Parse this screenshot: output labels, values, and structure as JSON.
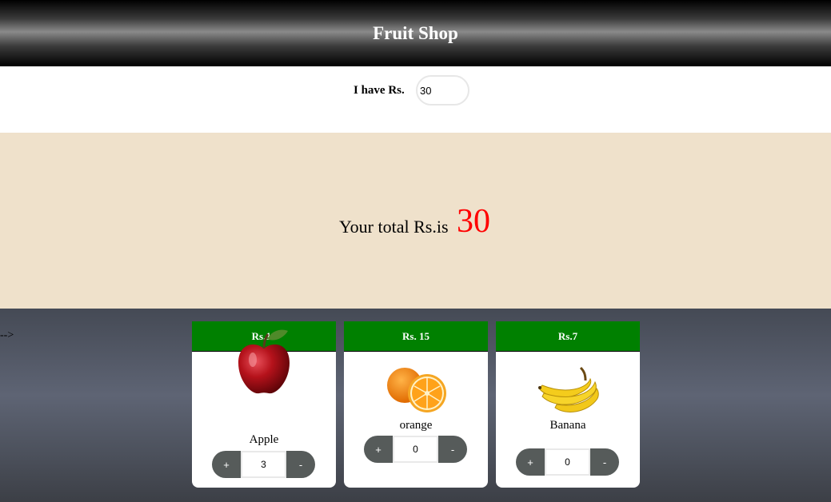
{
  "header": {
    "title": "Fruit Shop"
  },
  "budget": {
    "label": "I have Rs.",
    "value": "30"
  },
  "total": {
    "label": "Your total Rs.is",
    "value": "30",
    "value_color": "#ff0000"
  },
  "comment_arrow": "-->",
  "colors": {
    "card_header": "#008000",
    "total_band": "#efe1cb",
    "button": "#565b5a"
  },
  "products": [
    {
      "price": "Rs.10",
      "name": "Apple",
      "icon": "apple-icon",
      "plus": "+",
      "qty": "3",
      "minus": "-"
    },
    {
      "price": "Rs. 15",
      "name": "orange",
      "icon": "orange-icon",
      "plus": "+",
      "qty": "0",
      "minus": "-"
    },
    {
      "price": "Rs.7",
      "name": "Banana",
      "icon": "banana-icon",
      "plus": "+",
      "qty": "0",
      "minus": "-"
    }
  ]
}
